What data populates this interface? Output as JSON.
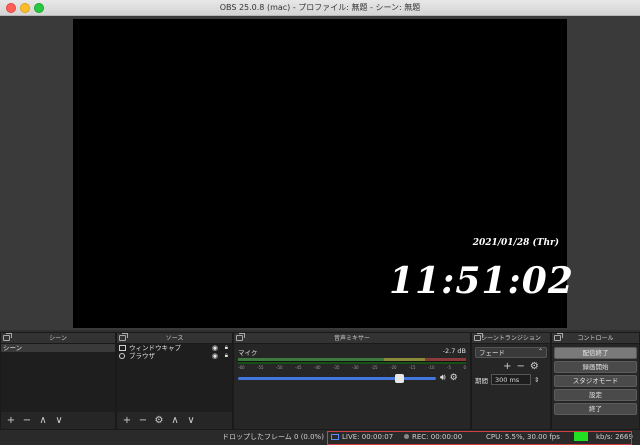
{
  "window": {
    "title": "OBS 25.0.8 (mac) - プロファイル: 無題 - シーン: 無題"
  },
  "preview": {
    "date": "2021/01/28 (Thr)",
    "time": "11:51:02"
  },
  "scenes": {
    "title": "シーン",
    "items": [
      "シーン"
    ]
  },
  "sources": {
    "title": "ソース",
    "items": [
      "ウィンドウキャプ",
      "ブラウザ"
    ]
  },
  "mixer": {
    "title": "音声ミキサー",
    "channel": "マイク",
    "level": "-2.7 dB",
    "ticks": [
      "-60",
      "-55",
      "-50",
      "-45",
      "-40",
      "-35",
      "-30",
      "-25",
      "-20",
      "-15",
      "-10",
      "-5",
      "0"
    ],
    "volume": 0.83
  },
  "transitions": {
    "title": "シーントランジション",
    "selected": "フェード",
    "duration_label": "期間",
    "duration": "300 ms"
  },
  "controls": {
    "title": "コントロール",
    "buttons": [
      "配信終了",
      "録画開始",
      "スタジオモード",
      "設定",
      "終了"
    ]
  },
  "status": {
    "dropped": "ドロップしたフレーム 0 (0.0%)",
    "live": "LIVE: 00:00:07",
    "rec": "REC: 00:00:00",
    "cpu": "CPU: 5.5%, 30.00 fps",
    "kbs": "kb/s: 2669"
  },
  "colors": {
    "accent": "#4477dd",
    "bitrate_ok": "#22e022",
    "highlight_box": "#d04040"
  }
}
